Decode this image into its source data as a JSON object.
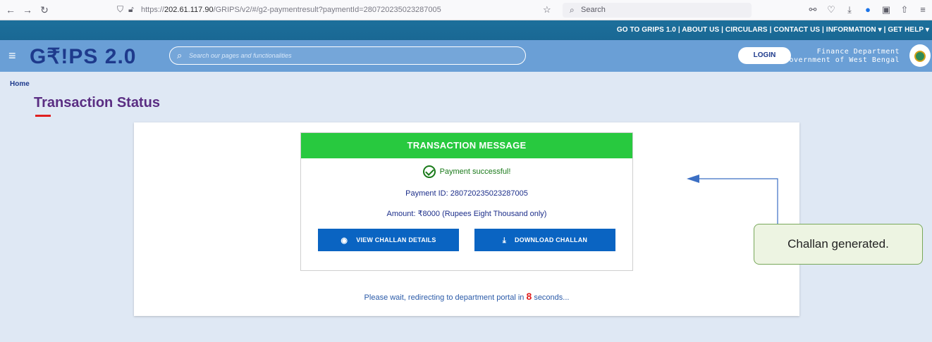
{
  "browser": {
    "url_prefix": "https://",
    "url_host": "202.61.117.90",
    "url_path": "/GRIPS/v2/#/g2-paymentresult?paymentId=280720235023287005",
    "search_placeholder": "Search"
  },
  "top_links": {
    "text": "GO TO GRIPS 1.0 | ABOUT US | CIRCULARS | CONTACT US | INFORMATION ▾ | GET HELP ▾"
  },
  "header": {
    "logo_text": "G₹!PS",
    "logo_version": "2.0",
    "search_placeholder": "Search our pages and functionalities",
    "login_label": "LOGIN",
    "dept_line1": "Finance Department",
    "dept_line2": "Government of West Bengal"
  },
  "page": {
    "breadcrumb": "Home",
    "title": "Transaction Status"
  },
  "message": {
    "header": "TRANSACTION MESSAGE",
    "success": "Payment successful!",
    "payment_id": "Payment ID: 280720235023287005",
    "amount": "Amount: ₹8000 (Rupees Eight Thousand only)",
    "view_button": "VIEW CHALLAN DETAILS",
    "download_button": "DOWNLOAD CHALLAN"
  },
  "redirect": {
    "prefix": "Please wait, redirecting to department portal in",
    "seconds": "8",
    "suffix": "seconds..."
  },
  "callout": {
    "text": "Challan generated."
  },
  "colors": {
    "top_bar": "#1c6f9b",
    "header_bg": "#6a9fd6",
    "success_green": "#28c93f",
    "button_blue": "#0a64c2",
    "title_purple": "#5a2d82",
    "countdown_red": "#e02020"
  }
}
